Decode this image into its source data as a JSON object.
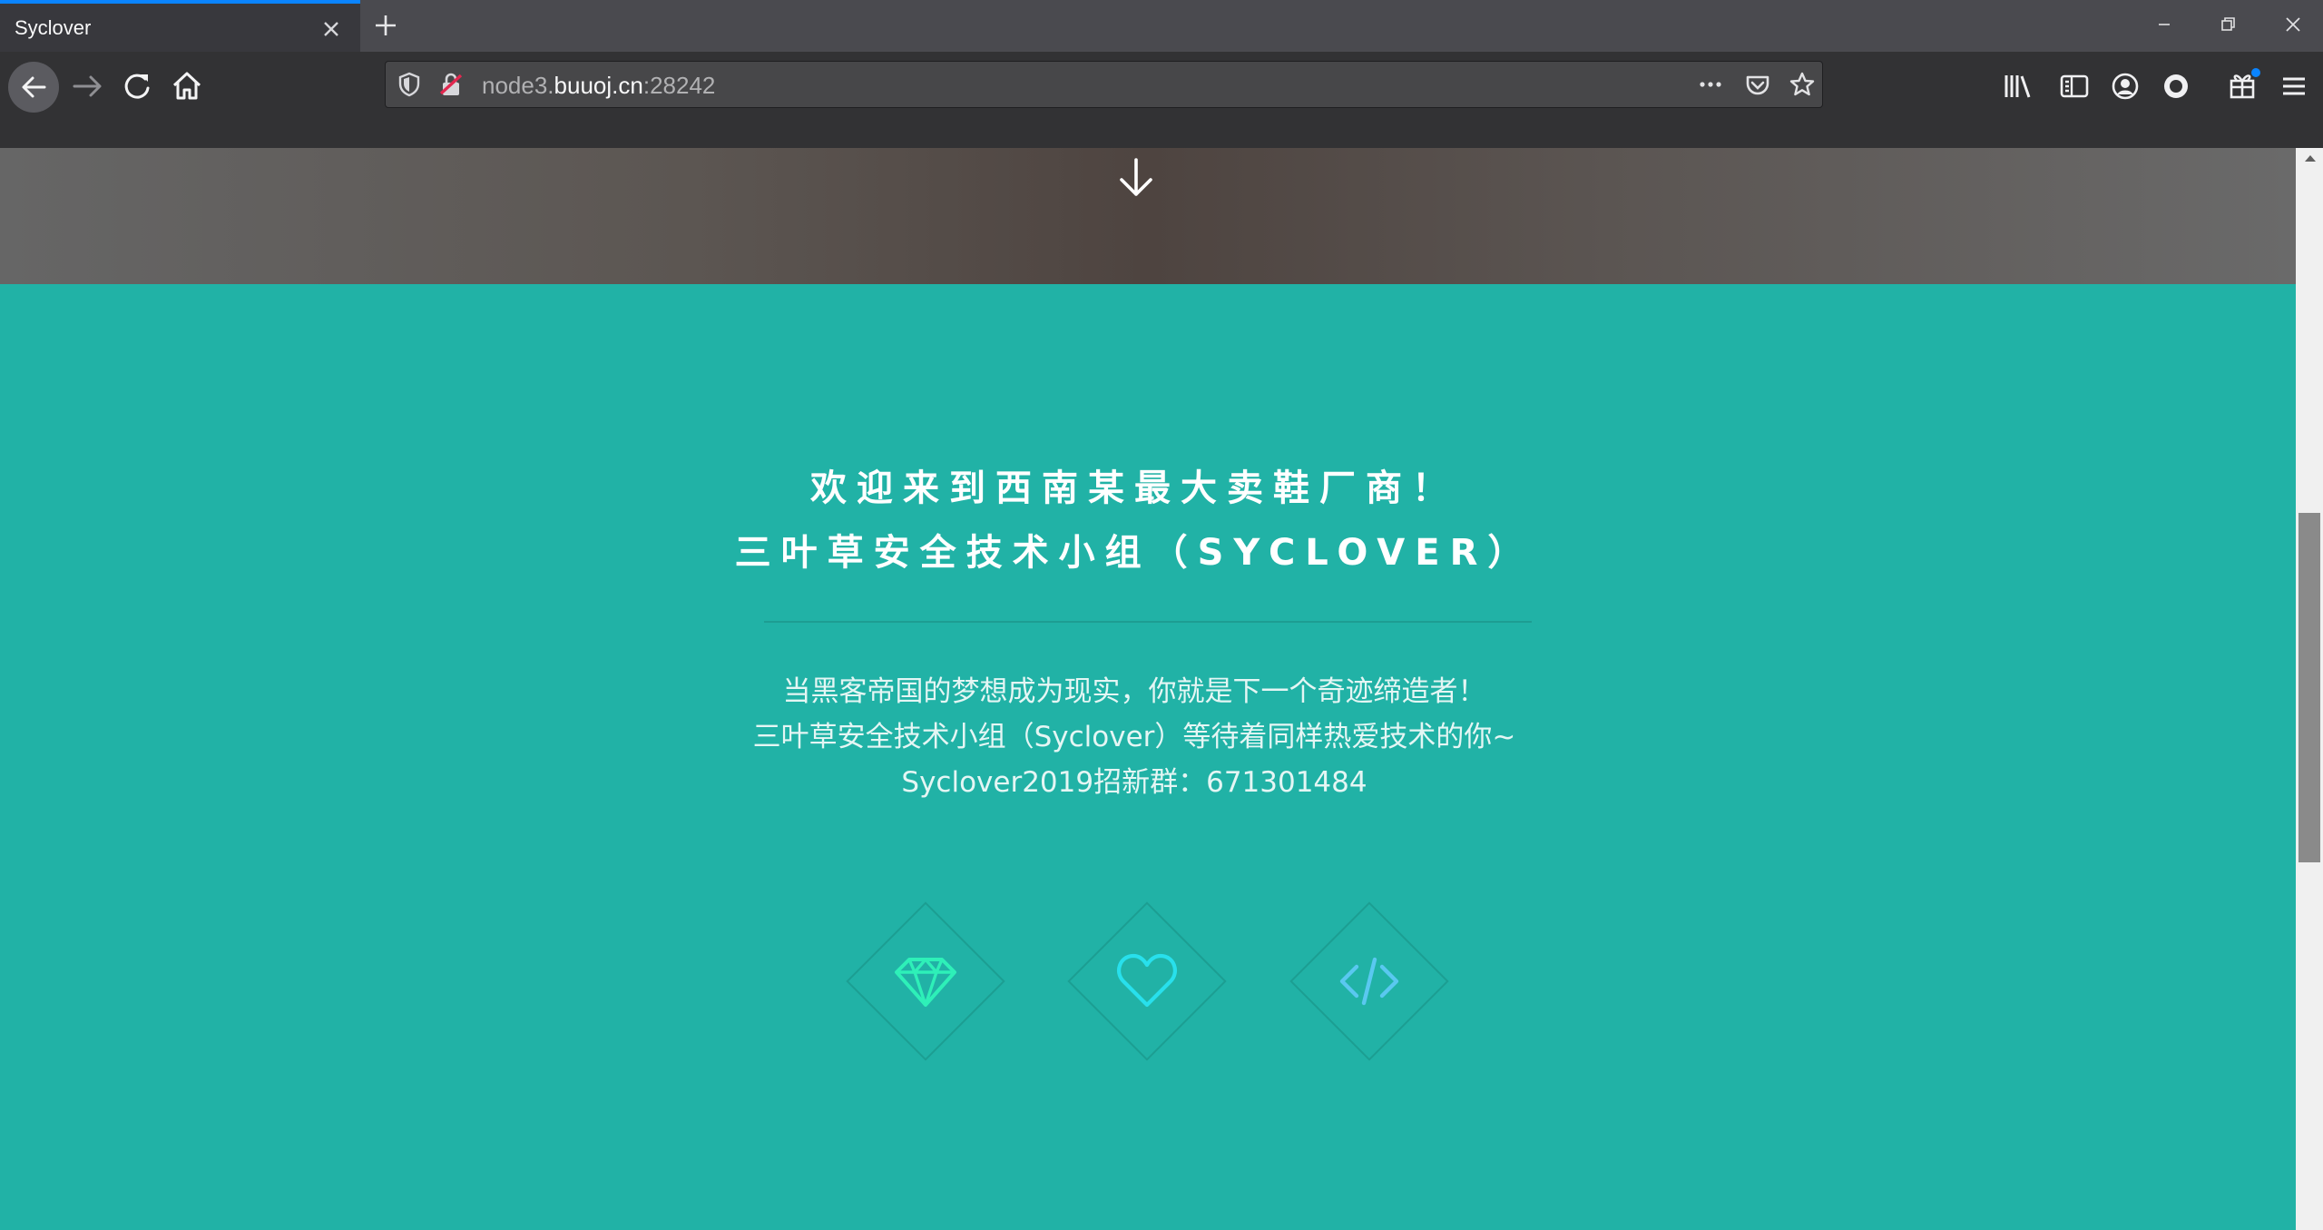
{
  "window": {
    "tab_title": "Syclover",
    "controls": [
      "minimize-icon",
      "restore-icon",
      "close-icon"
    ]
  },
  "toolbar": {
    "url_prefix": "node3.",
    "url_host": "buuoj.cn",
    "url_suffix": ":28242",
    "nav_icons": [
      "back-icon",
      "forward-icon",
      "reload-icon",
      "home-icon"
    ],
    "url_icons": [
      "shield-icon",
      "insecure-lock-icon",
      "more-icon",
      "pocket-icon",
      "bookmark-star-icon"
    ],
    "right_icons": [
      "library-icon",
      "sidebar-icon",
      "account-icon",
      "extension-icon",
      "whats-new-icon",
      "menu-icon"
    ]
  },
  "page": {
    "heading_line1": "欢迎来到西南某最大卖鞋厂商！",
    "heading_line2": "三叶草安全技术小组（SYCLOVER）",
    "para_line1": "当黑客帝国的梦想成为现实，你就是下一个奇迹缔造者！",
    "para_line2": "三叶草安全技术小组（Syclover）等待着同样热爱技术的你~",
    "para_line3": "Syclover2019招新群：671301484",
    "features": [
      "diamond-icon",
      "heart-icon",
      "code-icon"
    ],
    "colors": {
      "accent": "#21b2a6",
      "icon_green": "#2ef0b8",
      "icon_cyan": "#28e0ec",
      "icon_blue": "#5ac8f0"
    }
  }
}
